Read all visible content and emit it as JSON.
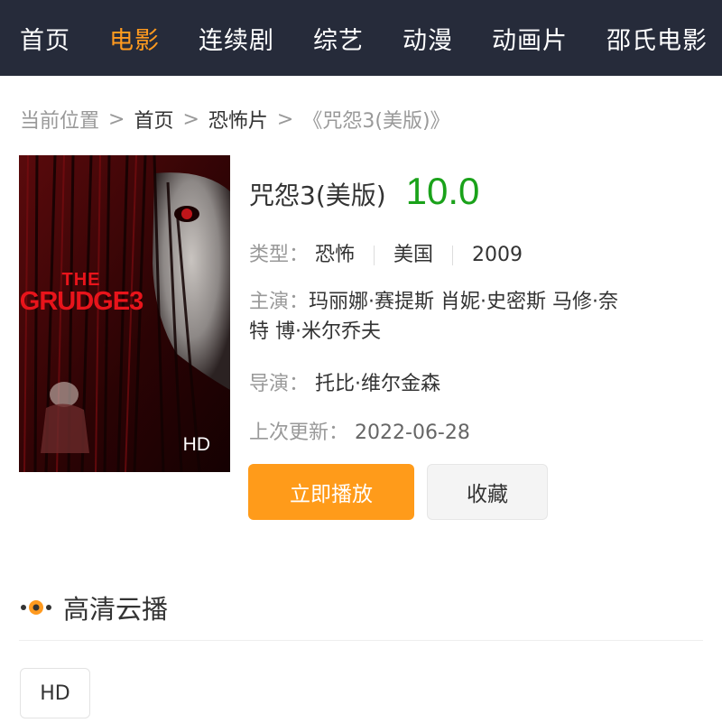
{
  "nav": {
    "items": [
      "首页",
      "电影",
      "连续剧",
      "综艺",
      "动漫",
      "动画片",
      "邵氏电影"
    ],
    "active_index": 1
  },
  "breadcrumb": {
    "prefix": "当前位置",
    "links": [
      "首页",
      "恐怖片"
    ],
    "current": "《咒怨3(美版)》"
  },
  "poster": {
    "poster_title_line1": "THE",
    "poster_title_line2": "GRUDGE3",
    "quality": "HD"
  },
  "movie": {
    "title": "咒怨3(美版)",
    "rating": "10.0",
    "type_label": "类型：",
    "tags": [
      "恐怖",
      "美国",
      "2009"
    ],
    "cast_label": "主演：",
    "cast_line1": "玛丽娜·赛提斯 肖妮·史密斯 马修·奈",
    "cast_line2": "特 博·米尔乔夫",
    "director_label": "导演：",
    "director": "托比·维尔金森",
    "updated_label": "上次更新：",
    "updated": "2022-06-28"
  },
  "actions": {
    "play": "立即播放",
    "favorite": "收藏"
  },
  "section": {
    "title": "高清云播",
    "icon": "cloud-play-icon"
  },
  "sources": [
    "HD"
  ],
  "colors": {
    "nav_bg": "#262b3a",
    "accent": "#ff9a1f",
    "rating": "#1aa21a"
  }
}
